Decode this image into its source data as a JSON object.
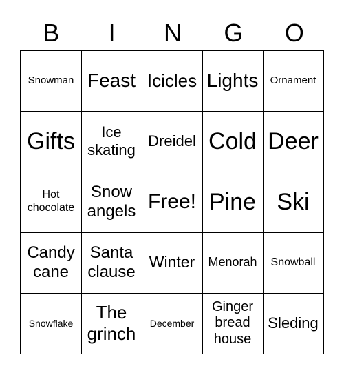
{
  "header": [
    "B",
    "I",
    "N",
    "G",
    "O"
  ],
  "cells": [
    "Snowman",
    "Feast",
    "Icicles",
    "Lights",
    "Ornament",
    "Gifts",
    "Ice skating",
    "Dreidel",
    "Cold",
    "Deer",
    "Hot chocolate",
    "Snow angels",
    "Free!",
    "Pine",
    "Ski",
    "Candy cane",
    "Santa clause",
    "Winter",
    "Menorah",
    "Snowball",
    "Snowflake",
    "The grinch",
    "December",
    "Ginger bread house",
    "Sleding"
  ]
}
